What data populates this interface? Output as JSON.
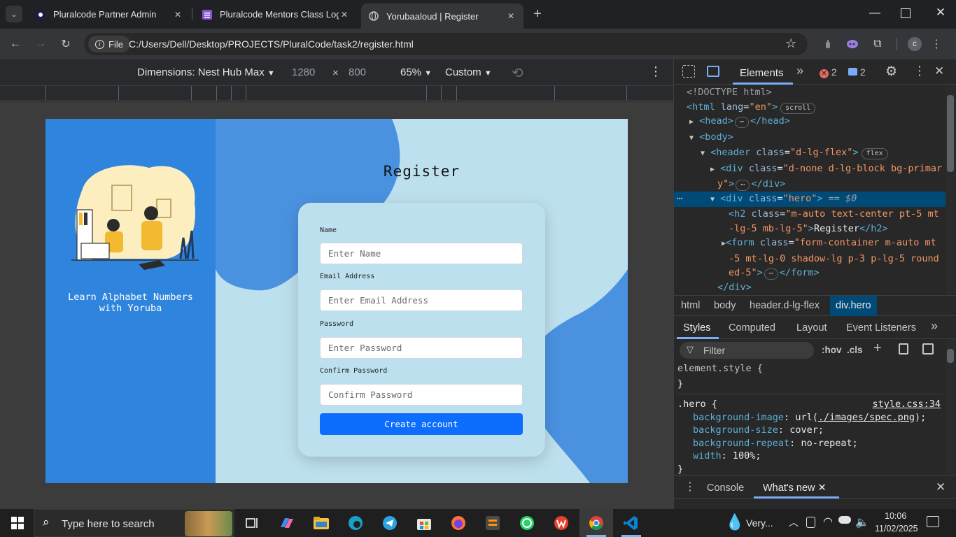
{
  "tabs": [
    {
      "title": "Pluralcode Partner Admin",
      "icon": "pluralcode-icon"
    },
    {
      "title": "Pluralcode Mentors Class Log",
      "icon": "class-log-icon"
    },
    {
      "title": "Yorubaaloud | Register",
      "icon": "globe-icon",
      "active": true
    }
  ],
  "address": {
    "chip": "File",
    "url": "C:/Users/Dell/Desktop/PROJECTS/PluralCode/task2/register.html"
  },
  "profile_initial": "c",
  "device": {
    "label": "Dimensions: Nest Hub Max",
    "width": "1280",
    "x": "×",
    "height": "800",
    "zoom": "65%",
    "throttle": "Custom"
  },
  "page": {
    "tagline": "Learn Alphabet Numbers with Yoruba",
    "heading": "Register",
    "fields": [
      {
        "label": "Name",
        "placeholder": "Enter Name"
      },
      {
        "label": "Email Address",
        "placeholder": "Enter Email Address"
      },
      {
        "label": "Password",
        "placeholder": "Enter Password"
      },
      {
        "label": "Confirm Password",
        "placeholder": "Confirm Password"
      }
    ],
    "submit": "Create account"
  },
  "devtools": {
    "tab_elements": "Elements",
    "errors": "2",
    "messages": "2",
    "dom": {
      "doctype": "<!DOCTYPE html>",
      "html_open": "<html",
      "html_attr": "lang",
      "html_val": "\"en\"",
      "scroll_pill": "scroll",
      "head": "<head>",
      "head_close": "</head>",
      "body": "<body>",
      "header_open": "<header",
      "header_attr": "class",
      "header_val": "\"d-lg-flex\"",
      "flex_pill": "flex",
      "div1_a": "<div",
      "div1_attr": "class",
      "div1_val1": "\"d-none d-lg-block bg-primar",
      "div1_val2": "y\"",
      "div1_close": "</div>",
      "hero_open": "<div",
      "hero_attr": "class",
      "hero_val": "\"hero\"",
      "hero_eq": "== $0",
      "h2_open": "<h2",
      "h2_attr": "class",
      "h2_val1": "\"m-auto text-center pt-5 mt",
      "h2_val2": "-lg-5 mb-lg-5\"",
      "h2_text": "Register",
      "h2_close": "</h2>",
      "form_open": "<form",
      "form_attr": "class",
      "form_val1": "\"form-container m-auto mt",
      "form_val2": "-5 mt-lg-0 shadow-lg p-3 p-lg-5 round",
      "form_val3": "ed-5\"",
      "form_close": "</form>",
      "div_close": "</div>"
    },
    "breadcrumbs": [
      "html",
      "body",
      "header.d-lg-flex",
      "div.hero"
    ],
    "style_tabs": [
      "Styles",
      "Computed",
      "Layout",
      "Event Listeners"
    ],
    "filter_placeholder": "Filter",
    "hov": ":hov",
    "cls": ".cls",
    "element_style": "element.style {",
    "close_brace": "}",
    "rule_selector": ".hero {",
    "rule_source": "style.css:34",
    "props": [
      {
        "name": "background-image",
        "value": "url(",
        "link": "./images/spec.png",
        "tail": ");"
      },
      {
        "name": "background-size",
        "value": "cover;",
        "link": "",
        "tail": ""
      },
      {
        "name": "background-repeat",
        "value": "no-repeat;",
        "link": "",
        "tail": ""
      },
      {
        "name": "width",
        "value": "100%;",
        "link": "",
        "tail": ""
      }
    ],
    "drawer_tabs": [
      "Console",
      "What's new"
    ]
  },
  "taskbar": {
    "search": "Type here to search",
    "weather": "Very...",
    "time": "10:06",
    "date": "11/02/2025"
  }
}
